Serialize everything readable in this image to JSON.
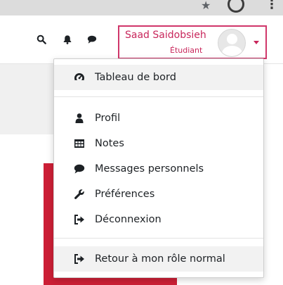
{
  "user": {
    "name": "Saad Saidobsieh",
    "role": "Étudiant"
  },
  "colors": {
    "accent": "#c8265b",
    "text": "#1d2125",
    "brand_red": "#cc1f36"
  },
  "navbar": {
    "icons": [
      "search-icon",
      "bell-icon",
      "comment-icon"
    ]
  },
  "menu": {
    "dashboard": {
      "label": "Tableau de bord",
      "icon": "tachometer-icon"
    },
    "profile": {
      "label": "Profil",
      "icon": "user-icon"
    },
    "grades": {
      "label": "Notes",
      "icon": "table-icon"
    },
    "messages": {
      "label": "Messages personnels",
      "icon": "comment-icon"
    },
    "preferences": {
      "label": "Préférences",
      "icon": "wrench-icon"
    },
    "logout": {
      "label": "Déconnexion",
      "icon": "sign-out-icon"
    },
    "return_role": {
      "label": "Retour à mon rôle normal",
      "icon": "sign-out-icon"
    }
  }
}
